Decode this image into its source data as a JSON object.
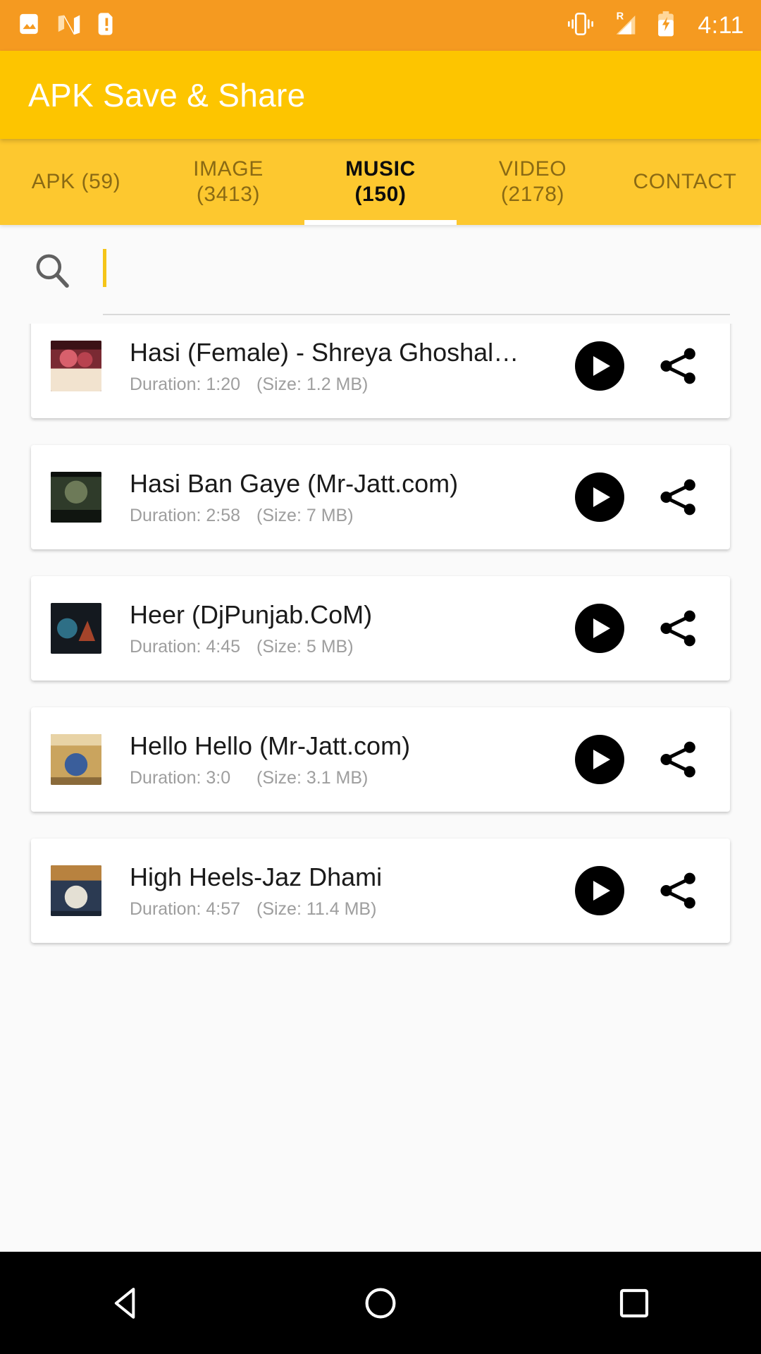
{
  "status_bar": {
    "time": "4:11",
    "left_icons": [
      "image-icon",
      "nova-launcher-icon",
      "sim-alert-icon"
    ],
    "right_icons": [
      "vibrate-icon",
      "signal-roaming-icon",
      "battery-charging-icon"
    ],
    "roaming_label": "R",
    "background_color": "#F59A20"
  },
  "app_bar": {
    "title": "APK Save & Share",
    "background_color": "#FDC500",
    "title_color": "#FFFFFF"
  },
  "tabs": {
    "active_index": 2,
    "indicator_color": "#FFFFFF",
    "background_color": "#FDC82F",
    "items": [
      {
        "line1": "APK (59)",
        "line2": ""
      },
      {
        "line1": "IMAGE",
        "line2": "(3413)"
      },
      {
        "line1": "MUSIC",
        "line2": "(150)"
      },
      {
        "line1": "VIDEO",
        "line2": "(2178)"
      },
      {
        "line1": "CONTACT",
        "line2": ""
      }
    ]
  },
  "search": {
    "icon": "search-icon",
    "value": "",
    "placeholder": "",
    "caret_color": "#F5C518"
  },
  "list": {
    "items": [
      {
        "title": "Hasi (Female) - Shreya Ghoshal -...",
        "duration_label": "Duration: 1:20",
        "size_label": "(Size: 1.2 MB)",
        "thumb_colors": [
          "#7a2a33",
          "#d8606c",
          "#f2e3cf"
        ]
      },
      {
        "title": "Hasi Ban Gaye (Mr-Jatt.com)",
        "duration_label": "Duration: 2:58",
        "size_label": "(Size: 7 MB)",
        "thumb_colors": [
          "#2f3b2a",
          "#6d7a58",
          "#101510"
        ]
      },
      {
        "title": "Heer (DjPunjab.CoM)",
        "duration_label": "Duration: 4:45",
        "size_label": "(Size: 5 MB)",
        "thumb_colors": [
          "#14191f",
          "#2e6f86",
          "#a5442a"
        ]
      },
      {
        "title": "Hello Hello (Mr-Jatt.com)",
        "duration_label": "Duration: 3:0",
        "size_label": "(Size: 3.1 MB)",
        "thumb_colors": [
          "#caa45e",
          "#e8d3a6",
          "#3a5e9b"
        ]
      },
      {
        "title": "High Heels-Jaz Dhami",
        "duration_label": "Duration: 4:57",
        "size_label": "(Size: 11.4 MB)",
        "thumb_colors": [
          "#2b3a52",
          "#b8823f",
          "#e4e0d4"
        ]
      }
    ],
    "play_button": "play-button",
    "share_button": "share-button"
  },
  "nav_bar": {
    "back": "back-nav-button",
    "home": "home-nav-button",
    "recents": "recents-nav-button",
    "background_color": "#000000"
  }
}
